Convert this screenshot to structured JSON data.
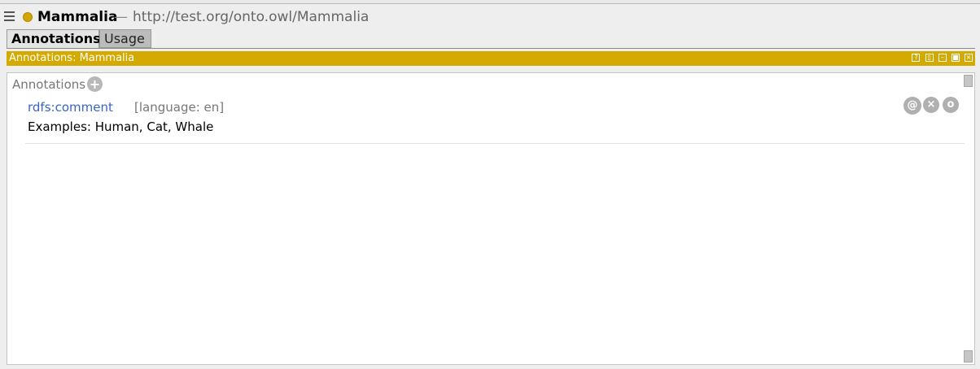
{
  "title_bar": {
    "entity_name": "Mammalia",
    "separator": "—",
    "entity_iri": "http://test.org/onto.owl/Mammalia",
    "menu_icon": "hamburger-menu-icon",
    "class_icon": "class-dot-icon",
    "class_icon_color": "#d4a400"
  },
  "tabs": [
    {
      "label": "Annotations",
      "active": true
    },
    {
      "label": "Usage",
      "active": false
    }
  ],
  "view_header": {
    "title": "Annotations: Mammalia",
    "color": "#d4a900",
    "buttons": [
      {
        "icon": "help-icon",
        "glyph": "?"
      },
      {
        "icon": "split-view-icon",
        "glyph": "▯"
      },
      {
        "icon": "minimize-icon",
        "glyph": "–"
      },
      {
        "icon": "maximize-icon",
        "glyph": "■"
      },
      {
        "icon": "close-icon",
        "glyph": "×"
      }
    ]
  },
  "annotations_section": {
    "label": "Annotations",
    "add_glyph": "+",
    "items": [
      {
        "property": "rdfs:comment",
        "language": "[language: en]",
        "value": "Examples: Human, Cat, Whale",
        "actions": [
          {
            "icon": "annotate-icon",
            "glyph": "@"
          },
          {
            "icon": "delete-icon",
            "glyph": "×"
          },
          {
            "icon": "edit-icon",
            "glyph": "o"
          }
        ]
      }
    ]
  }
}
